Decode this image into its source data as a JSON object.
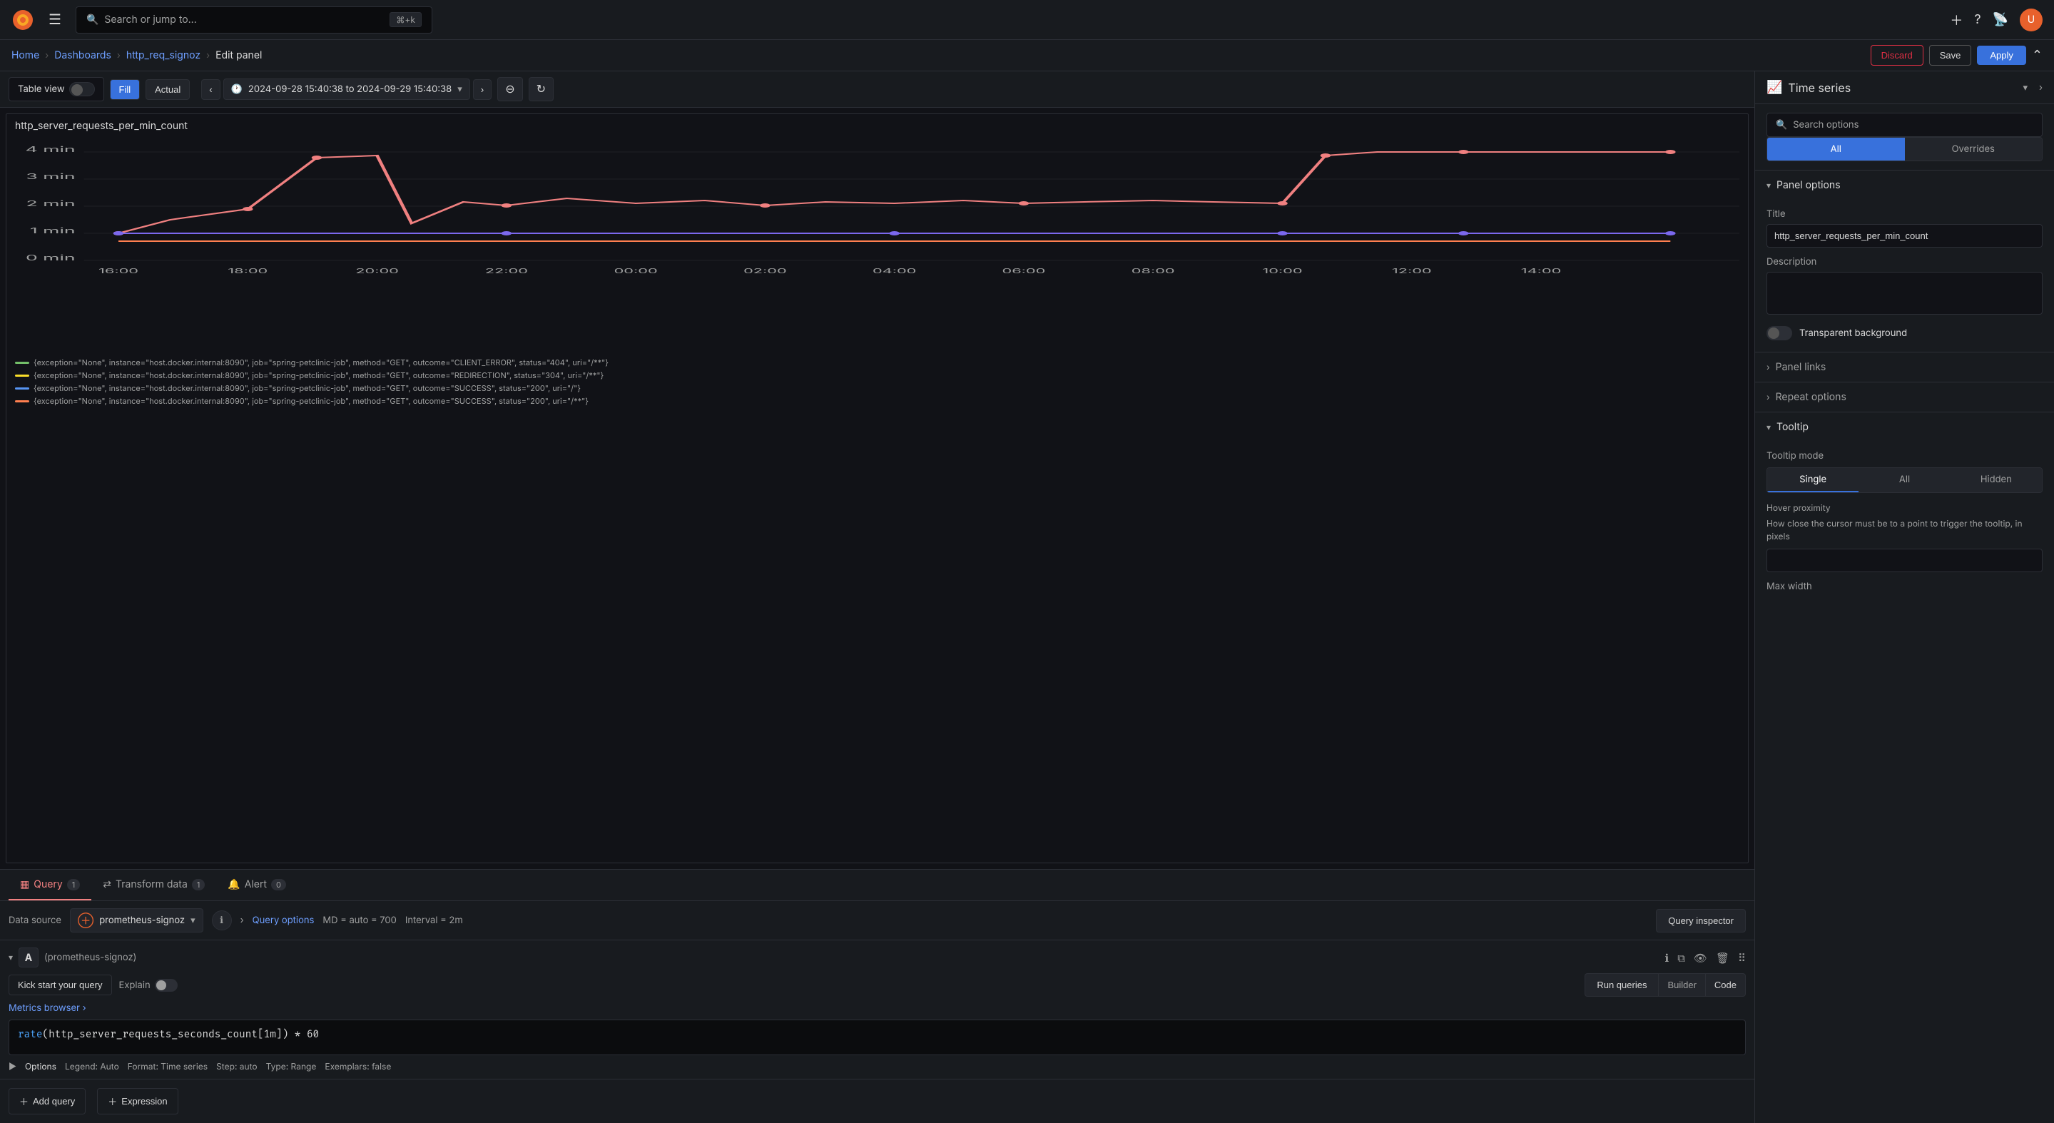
{
  "topbar": {
    "search_placeholder": "Search or jump to...",
    "shortcut": "⌘+k"
  },
  "breadcrumb": {
    "home": "Home",
    "dashboards": "Dashboards",
    "dashboard_name": "http_req_signoz",
    "current": "Edit panel"
  },
  "header_buttons": {
    "discard": "Discard",
    "save": "Save",
    "apply": "Apply"
  },
  "panel_toolbar": {
    "table_view": "Table view",
    "fill": "Fill",
    "actual": "Actual",
    "time_range": "2024-09-28 15:40:38 to 2024-09-29 15:40:38"
  },
  "viz": {
    "title": "http_server_requests_per_min_count",
    "type": "Time series",
    "y_labels": [
      "4 min",
      "3 min",
      "2 min",
      "1 min",
      "0 min"
    ],
    "x_labels": [
      "16:00",
      "18:00",
      "20:00",
      "22:00",
      "00:00",
      "02:00",
      "04:00",
      "06:00",
      "08:00",
      "10:00",
      "12:00",
      "14:00"
    ],
    "legend_items": [
      {
        "color": "#73bf69",
        "text": "{exception=\"None\", instance=\"host.docker.internal:8090\", job=\"spring-petclinic-job\", method=\"GET\", outcome=\"CLIENT_ERROR\", status=\"404\", uri=\"/**\"}"
      },
      {
        "color": "#fade2a",
        "text": "{exception=\"None\", instance=\"host.docker.internal:8090\", job=\"spring-petclinic-job\", method=\"GET\", outcome=\"REDIRECTION\", status=\"304\", uri=\"/**\"}"
      },
      {
        "color": "#5794f2",
        "text": "{exception=\"None\", instance=\"host.docker.internal:8090\", job=\"spring-petclinic-job\", method=\"GET\", outcome=\"SUCCESS\", status=\"200\", uri=\"/\"}"
      },
      {
        "color": "#ff7f50",
        "text": "{exception=\"None\", instance=\"host.docker.internal:8090\", job=\"spring-petclinic-job\", method=\"GET\", outcome=\"SUCCESS\", status=\"200\", uri=\"/**\"}"
      }
    ]
  },
  "query_section": {
    "tabs": [
      {
        "label": "Query",
        "badge": "1",
        "icon": "grid"
      },
      {
        "label": "Transform data",
        "badge": "1",
        "icon": "shuffle"
      },
      {
        "label": "Alert",
        "badge": "0",
        "icon": "bell"
      }
    ],
    "datasource_label": "Data source",
    "datasource_name": "prometheus-signoz",
    "query_options_label": "Query options",
    "md_value": "MD = auto = 700",
    "interval_value": "Interval = 2m",
    "query_inspector_btn": "Query inspector",
    "query_rows": [
      {
        "letter": "A",
        "source": "(prometheus-signoz)",
        "expression": "rate(http_server_requests_seconds_count[1m]) * 60",
        "options": {
          "legend": "Auto",
          "format": "Time series",
          "step": "auto",
          "type": "Range",
          "exemplars": "false"
        }
      }
    ],
    "kickstart_label": "Kick start your query",
    "explain_label": "Explain",
    "run_queries_btn": "Run queries",
    "builder_btn": "Builder",
    "code_btn": "Code",
    "metrics_browser_label": "Metrics browser",
    "options_label": "Options",
    "legend_label": "Legend: Auto",
    "format_label": "Format: Time series",
    "step_label": "Step: auto",
    "type_label": "Type: Range",
    "exemplars_label": "Exemplars: false",
    "add_query_btn": "Add query",
    "expression_btn": "Expression"
  },
  "right_panel": {
    "type_label": "Time series",
    "search_options_placeholder": "Search options",
    "tabs": {
      "all": "All",
      "overrides": "Overrides"
    },
    "sections": {
      "panel_options": {
        "title": "Panel options",
        "title_label": "Title",
        "title_value": "http_server_requests_per_min_count",
        "description_label": "Description",
        "transparent_bg_label": "Transparent background"
      },
      "panel_links": {
        "title": "Panel links"
      },
      "repeat_options": {
        "title": "Repeat options"
      },
      "tooltip": {
        "title": "Tooltip",
        "tooltip_mode_label": "Tooltip mode",
        "modes": [
          "Single",
          "All",
          "Hidden"
        ],
        "hover_proximity_label": "Hover proximity",
        "hover_proximity_desc": "How close the cursor must be to a point to trigger the tooltip, in pixels",
        "max_width_label": "Max width"
      }
    }
  }
}
